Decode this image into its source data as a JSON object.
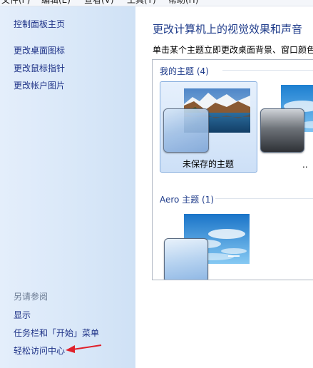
{
  "menubar": {
    "items": [
      "文件(F)",
      "编辑(E)",
      "查看(V)",
      "工具(T)",
      "帮助(H)"
    ]
  },
  "sidebar": {
    "home": "控制面板主页",
    "links": [
      "更改桌面图标",
      "更改鼠标指针",
      "更改帐户图片"
    ],
    "see_also_heading": "另请参阅",
    "see_also": [
      "显示",
      "任务栏和「开始」菜单",
      "轻松访问中心"
    ]
  },
  "main": {
    "title": "更改计算机上的视觉效果和声音",
    "description": "单击某个主题立即更改桌面背景、窗口颜色",
    "groups": [
      {
        "header": "我的主题 (4)",
        "themes": [
          {
            "label": "未保存的主题",
            "selected": true
          },
          {
            "label": "..",
            "selected": false
          }
        ]
      },
      {
        "header": "Aero 主题 (1)",
        "themes": [
          {
            "label": "",
            "selected": false
          }
        ]
      }
    ]
  },
  "annotation": {
    "arrow_color": "#e0202a"
  }
}
